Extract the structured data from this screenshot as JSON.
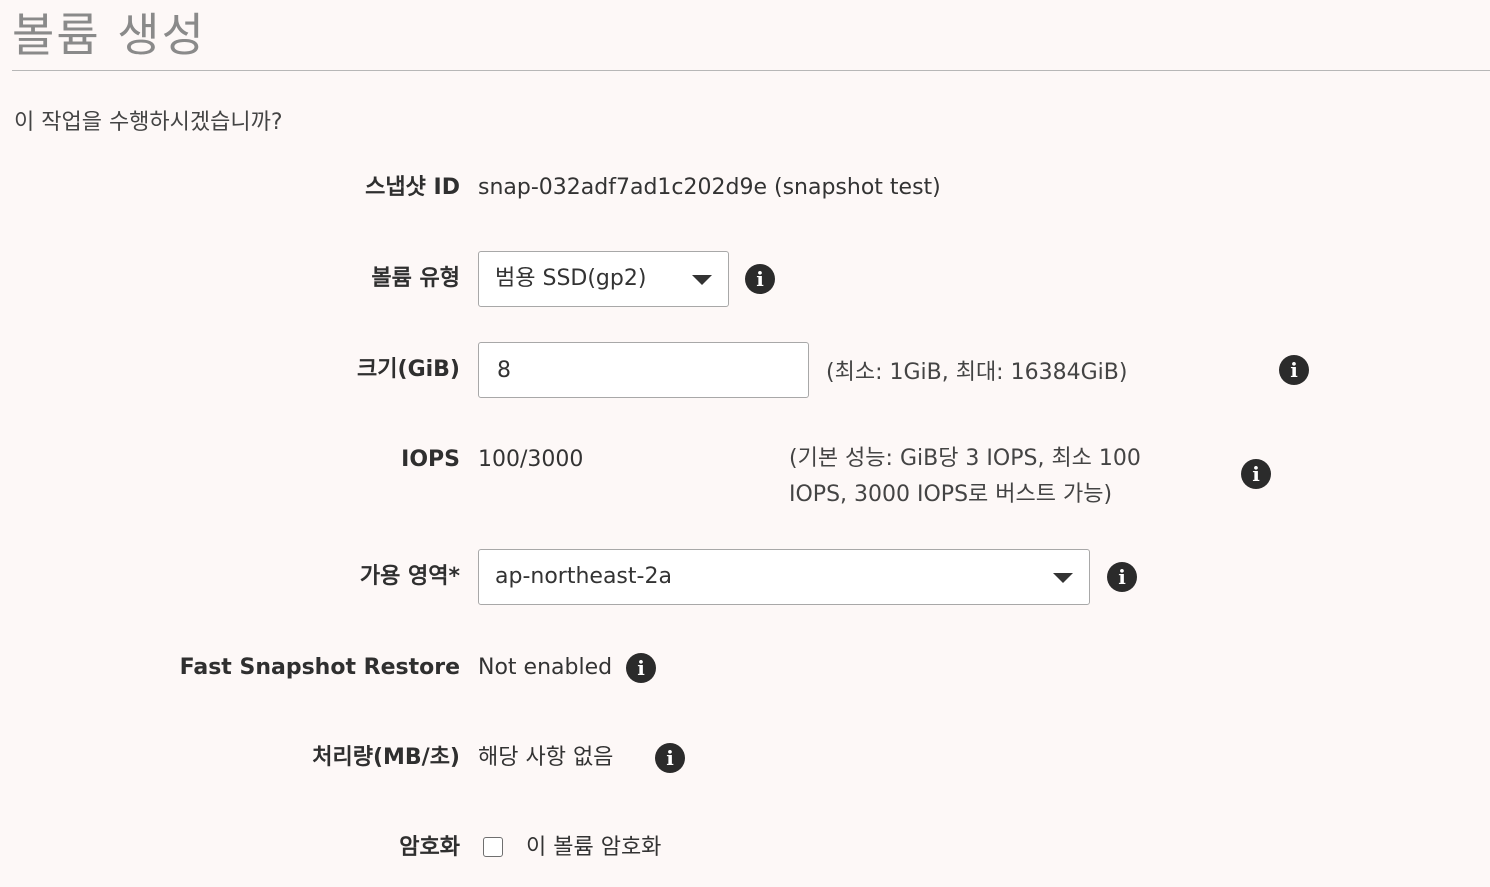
{
  "page": {
    "title": "볼륨 생성",
    "question": "이 작업을 수행하시겠습니까?"
  },
  "form": {
    "snapshot_id": {
      "label": "스냅샷 ID",
      "value": "snap-032adf7ad1c202d9e (snapshot test)"
    },
    "volume_type": {
      "label": "볼륨 유형",
      "selected": "범용 SSD(gp2)",
      "info_icon": "info-icon"
    },
    "size": {
      "label": "크기(GiB)",
      "value": "8",
      "hint": "(최소: 1GiB, 최대: 16384GiB)",
      "info_icon": "info-icon"
    },
    "iops": {
      "label": "IOPS",
      "value": "100/3000",
      "hint_line1": "(기본 성능: GiB당 3 IOPS, 최소 100",
      "hint_line2": "IOPS, 3000 IOPS로 버스트 가능)",
      "info_icon": "info-icon"
    },
    "availability_zone": {
      "label": "가용 영역*",
      "selected": "ap-northeast-2a",
      "info_icon": "info-icon"
    },
    "fast_snapshot_restore": {
      "label": "Fast Snapshot Restore",
      "value": "Not enabled",
      "info_icon": "info-icon"
    },
    "throughput": {
      "label": "처리량(MB/초)",
      "value": "해당 사항 없음",
      "info_icon": "info-icon"
    },
    "encryption": {
      "label": "암호화",
      "checkbox_label": "이 볼륨 암호화",
      "checked": false
    }
  },
  "icons": {
    "info_glyph": "i",
    "info_icon_color": "#2b2b2b"
  }
}
